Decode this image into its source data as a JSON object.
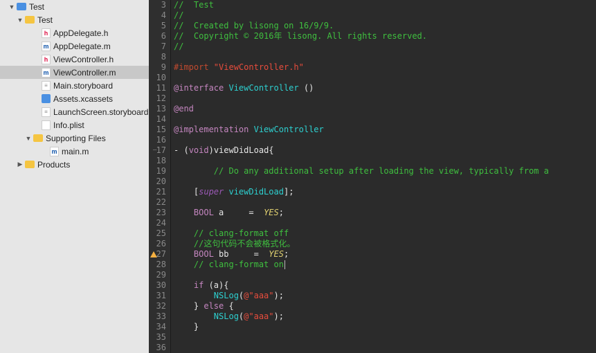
{
  "sidebar": {
    "items": [
      {
        "indent": 12,
        "disclosure": "down",
        "icon": "folder-blue",
        "label": "Test"
      },
      {
        "indent": 24,
        "disclosure": "down",
        "icon": "folder-yellow",
        "label": "Test"
      },
      {
        "indent": 48,
        "disclosure": "",
        "icon": "file-h",
        "iconText": "h",
        "label": "AppDelegate.h"
      },
      {
        "indent": 48,
        "disclosure": "",
        "icon": "file-m",
        "iconText": "m",
        "label": "AppDelegate.m"
      },
      {
        "indent": 48,
        "disclosure": "",
        "icon": "file-h",
        "iconText": "h",
        "label": "ViewController.h"
      },
      {
        "indent": 48,
        "disclosure": "",
        "icon": "file-m",
        "iconText": "m",
        "label": "ViewController.m",
        "selected": true
      },
      {
        "indent": 48,
        "disclosure": "",
        "icon": "file-sb",
        "iconText": "≡",
        "label": "Main.storyboard"
      },
      {
        "indent": 48,
        "disclosure": "",
        "icon": "file-assets",
        "label": "Assets.xcassets"
      },
      {
        "indent": 48,
        "disclosure": "",
        "icon": "file-sb",
        "iconText": "≡",
        "label": "LaunchScreen.storyboard"
      },
      {
        "indent": 48,
        "disclosure": "",
        "icon": "file-plist",
        "label": "Info.plist"
      },
      {
        "indent": 36,
        "disclosure": "down",
        "icon": "folder-yellow",
        "label": "Supporting Files"
      },
      {
        "indent": 60,
        "disclosure": "",
        "icon": "file-m",
        "iconText": "m",
        "label": "main.m"
      },
      {
        "indent": 24,
        "disclosure": "right",
        "icon": "folder-yellow",
        "label": "Products"
      }
    ]
  },
  "editor": {
    "lines": [
      {
        "n": 3,
        "tokens": [
          {
            "cls": "c-comment",
            "t": "//  Test"
          }
        ]
      },
      {
        "n": 4,
        "tokens": [
          {
            "cls": "c-comment",
            "t": "//"
          }
        ]
      },
      {
        "n": 5,
        "tokens": [
          {
            "cls": "c-comment",
            "t": "//  Created by lisong on 16/9/9."
          }
        ]
      },
      {
        "n": 6,
        "tokens": [
          {
            "cls": "c-comment",
            "t": "//  Copyright © 2016年 lisong. All rights reserved."
          }
        ]
      },
      {
        "n": 7,
        "tokens": [
          {
            "cls": "c-comment",
            "t": "//"
          }
        ]
      },
      {
        "n": 8,
        "tokens": []
      },
      {
        "n": 9,
        "tokens": [
          {
            "cls": "c-pp",
            "t": "#import "
          },
          {
            "cls": "c-str",
            "t": "\"ViewController.h\""
          }
        ]
      },
      {
        "n": 10,
        "tokens": []
      },
      {
        "n": 11,
        "tokens": [
          {
            "cls": "c-at",
            "t": "@interface"
          },
          {
            "cls": "",
            "t": " "
          },
          {
            "cls": "c-class",
            "t": "ViewController"
          },
          {
            "cls": "",
            "t": " ()"
          }
        ]
      },
      {
        "n": 12,
        "tokens": []
      },
      {
        "n": 13,
        "tokens": [
          {
            "cls": "c-at",
            "t": "@end"
          }
        ]
      },
      {
        "n": 14,
        "tokens": []
      },
      {
        "n": 15,
        "tokens": [
          {
            "cls": "c-at",
            "t": "@implementation"
          },
          {
            "cls": "",
            "t": " "
          },
          {
            "cls": "c-class",
            "t": "ViewController"
          }
        ]
      },
      {
        "n": 16,
        "tokens": []
      },
      {
        "n": 17,
        "fold": true,
        "tokens": [
          {
            "cls": "",
            "t": "- ("
          },
          {
            "cls": "c-type",
            "t": "void"
          },
          {
            "cls": "",
            "t": ")viewDidLoad{"
          }
        ]
      },
      {
        "n": 18,
        "tokens": []
      },
      {
        "n": 19,
        "tokens": [
          {
            "cls": "",
            "t": "        "
          },
          {
            "cls": "c-comment",
            "t": "// Do any additional setup after loading the view, typically from a "
          }
        ]
      },
      {
        "n": 20,
        "tokens": []
      },
      {
        "n": 21,
        "tokens": [
          {
            "cls": "",
            "t": "    ["
          },
          {
            "cls": "c-super",
            "t": "super"
          },
          {
            "cls": "",
            "t": " "
          },
          {
            "cls": "c-fn",
            "t": "viewDidLoad"
          },
          {
            "cls": "",
            "t": "];"
          }
        ]
      },
      {
        "n": 22,
        "tokens": []
      },
      {
        "n": 23,
        "tokens": [
          {
            "cls": "",
            "t": "    "
          },
          {
            "cls": "c-type",
            "t": "BOOL"
          },
          {
            "cls": "",
            "t": " a     =  "
          },
          {
            "cls": "c-macro",
            "t": "YES"
          },
          {
            "cls": "",
            "t": ";"
          }
        ]
      },
      {
        "n": 24,
        "tokens": []
      },
      {
        "n": 25,
        "tokens": [
          {
            "cls": "",
            "t": "    "
          },
          {
            "cls": "c-comment",
            "t": "// clang-format off"
          }
        ]
      },
      {
        "n": 26,
        "tokens": [
          {
            "cls": "",
            "t": "    "
          },
          {
            "cls": "c-comment",
            "t": "//这句代码不会被格式化。"
          }
        ]
      },
      {
        "n": 27,
        "warn": true,
        "tokens": [
          {
            "cls": "",
            "t": "    "
          },
          {
            "cls": "c-type",
            "t": "BOOL"
          },
          {
            "cls": "",
            "t": " bb     =  "
          },
          {
            "cls": "c-macro",
            "t": "YES"
          },
          {
            "cls": "",
            "t": ";"
          }
        ]
      },
      {
        "n": 28,
        "cursor": true,
        "tokens": [
          {
            "cls": "",
            "t": "    "
          },
          {
            "cls": "c-comment",
            "t": "// clang-format on"
          }
        ]
      },
      {
        "n": 29,
        "tokens": []
      },
      {
        "n": 30,
        "tokens": [
          {
            "cls": "",
            "t": "    "
          },
          {
            "cls": "c-kw",
            "t": "if"
          },
          {
            "cls": "",
            "t": " (a){"
          }
        ]
      },
      {
        "n": 31,
        "tokens": [
          {
            "cls": "",
            "t": "        "
          },
          {
            "cls": "c-fn",
            "t": "NSLog"
          },
          {
            "cls": "",
            "t": "("
          },
          {
            "cls": "c-str",
            "t": "@\"aaa\""
          },
          {
            "cls": "",
            "t": ");"
          }
        ]
      },
      {
        "n": 32,
        "tokens": [
          {
            "cls": "",
            "t": "    } "
          },
          {
            "cls": "c-kw",
            "t": "else"
          },
          {
            "cls": "",
            "t": " {"
          }
        ]
      },
      {
        "n": 33,
        "tokens": [
          {
            "cls": "",
            "t": "        "
          },
          {
            "cls": "c-fn",
            "t": "NSLog"
          },
          {
            "cls": "",
            "t": "("
          },
          {
            "cls": "c-str",
            "t": "@\"aaa\""
          },
          {
            "cls": "",
            "t": ");"
          }
        ]
      },
      {
        "n": 34,
        "tokens": [
          {
            "cls": "",
            "t": "    }"
          }
        ]
      },
      {
        "n": 35,
        "tokens": []
      },
      {
        "n": 36,
        "tokens": []
      }
    ]
  }
}
